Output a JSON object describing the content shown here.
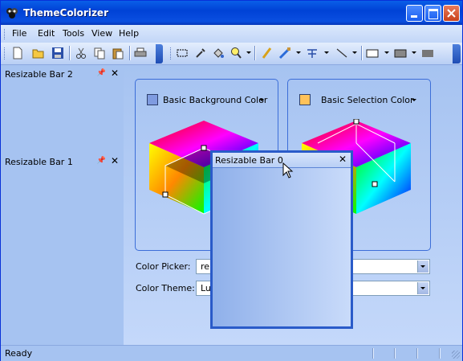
{
  "window": {
    "title": "ThemeColorizer"
  },
  "menu": {
    "items": [
      "File",
      "Edit",
      "Tools",
      "View",
      "Help"
    ]
  },
  "toolbar": {
    "icons": [
      "new-icon",
      "open-icon",
      "save-icon",
      "cut-icon",
      "copy-icon",
      "paste-icon",
      "print-icon",
      "select-icon",
      "eyedropper-icon",
      "fill-icon",
      "zoom-icon",
      "pencil-icon",
      "brush-icon",
      "spray-icon",
      "line-icon",
      "rectangle-icon",
      "filled-rectangle-icon",
      "color-icon"
    ]
  },
  "bars": [
    {
      "label": "Resizable Bar 2"
    },
    {
      "label": "Resizable Bar 1"
    }
  ],
  "groups": [
    {
      "label": "Basic Background Color",
      "swatch": "#7f9be0"
    },
    {
      "label": "Basic Selection Color",
      "swatch": "#ffc25a"
    }
  ],
  "form": {
    "picker_label": "Color Picker:",
    "picker_value": "re",
    "theme_label": "Color Theme:",
    "theme_value": "Lu"
  },
  "floating_bar": {
    "label": "Resizable Bar 0"
  },
  "status": {
    "text": "Ready"
  }
}
